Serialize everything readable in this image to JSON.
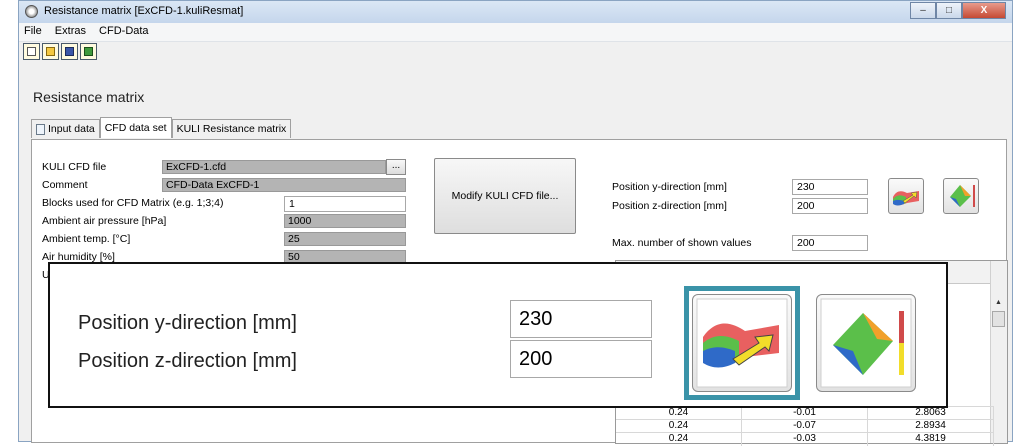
{
  "window": {
    "title": "Resistance matrix [ExCFD-1.kuliResmat]",
    "buttons": {
      "minimize": "–",
      "maximize": "□",
      "close": "X"
    }
  },
  "menu": {
    "items": [
      "File",
      "Extras",
      "CFD-Data"
    ]
  },
  "toolbar": {
    "icons": [
      "new-icon",
      "open-icon",
      "save-icon",
      "save-all-icon"
    ]
  },
  "page_title": "Resistance matrix",
  "tabs": [
    {
      "label": "Input data",
      "active": false
    },
    {
      "label": "CFD data set",
      "active": true
    },
    {
      "label": "KULI Resistance matrix",
      "active": false
    }
  ],
  "form": {
    "kuli_cfd_file": {
      "label": "KULI CFD file",
      "value": "ExCFD-1.cfd",
      "browse": "..."
    },
    "comment": {
      "label": "Comment",
      "value": "CFD-Data ExCFD-1"
    },
    "blocks": {
      "label": "Blocks used for CFD Matrix (e.g. 1;3;4)",
      "value": "1"
    },
    "pressure": {
      "label": "Ambient air pressure [hPa]",
      "value": "1000"
    },
    "temp": {
      "label": "Ambient temp. [°C]",
      "value": "25"
    },
    "humidity": {
      "label": "Air humidity [%]",
      "value": "50"
    },
    "partial_label": "U"
  },
  "modify_button": "Modify KULI CFD file...",
  "position": {
    "y_label": "Position y-direction [mm]",
    "y_value": "230",
    "z_label": "Position z-direction [mm]",
    "z_value": "200",
    "max_label": "Max. number of shown values",
    "max_value": "200"
  },
  "table": {
    "rows": [
      [
        "0.24",
        "-0.01",
        "2.8063"
      ],
      [
        "0.24",
        "-0.07",
        "2.8934"
      ],
      [
        "0.24",
        "-0.03",
        "4.3819"
      ]
    ]
  },
  "zoom": {
    "y_label": "Position y-direction [mm]",
    "y_value": "230",
    "z_label": "Position z-direction [mm]",
    "z_value": "200"
  },
  "colors": {
    "highlight": "#3a93a8",
    "readonly": "#b4b4b4"
  }
}
